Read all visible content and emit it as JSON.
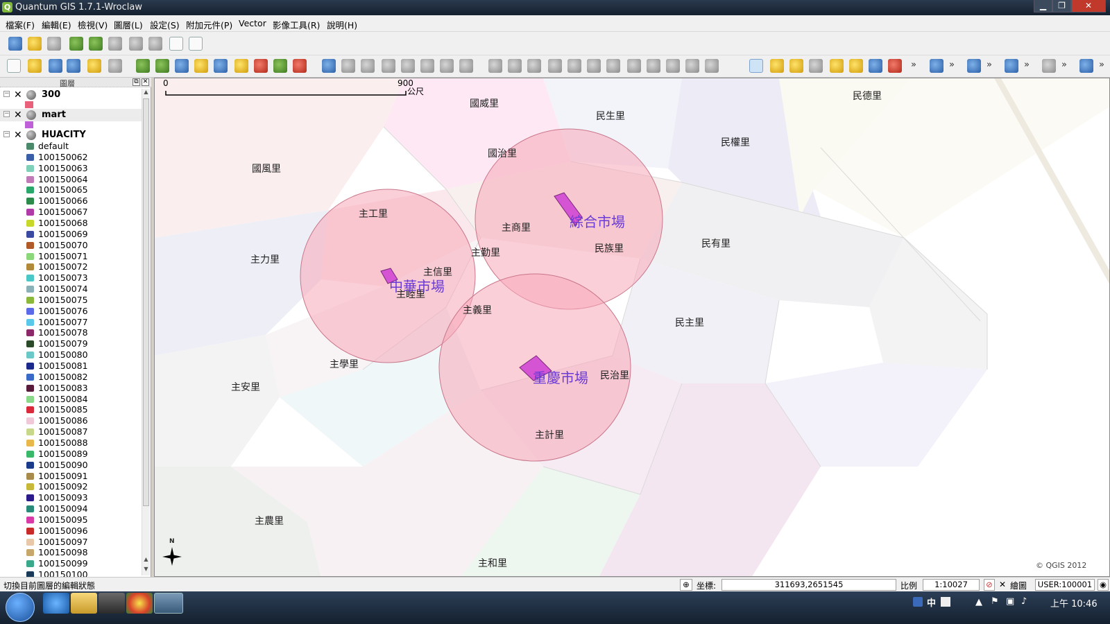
{
  "window": {
    "title": "Quantum GIS 1.7.1-Wroclaw",
    "min": "▁",
    "max": "❐",
    "close": "✕"
  },
  "menu": [
    "檔案(F)",
    "編輯(E)",
    "檢視(V)",
    "圖層(L)",
    "設定(S)",
    "附加元件(P)",
    "Vector",
    "影像工具(R)",
    "說明(H)"
  ],
  "panel": {
    "title": "圖層",
    "layers": [
      {
        "name": "300",
        "checked": "✕",
        "expand": "−"
      },
      {
        "name": "mart",
        "checked": "✕",
        "expand": "−"
      },
      {
        "name": "HUACITY",
        "checked": "✕",
        "expand": "−"
      }
    ],
    "classes": [
      {
        "label": "default",
        "color": "#4a8a6a"
      },
      {
        "label": "100150062",
        "color": "#3a5fa8"
      },
      {
        "label": "100150063",
        "color": "#7fd0b8"
      },
      {
        "label": "100150064",
        "color": "#c07ab8"
      },
      {
        "label": "100150065",
        "color": "#2aa86a"
      },
      {
        "label": "100150066",
        "color": "#2c8a4a"
      },
      {
        "label": "100150067",
        "color": "#b03aa8"
      },
      {
        "label": "100150068",
        "color": "#c8d82a"
      },
      {
        "label": "100150069",
        "color": "#3a4aa0"
      },
      {
        "label": "100150070",
        "color": "#b05a2a"
      },
      {
        "label": "100150071",
        "color": "#8ad87a"
      },
      {
        "label": "100150072",
        "color": "#b08a3a"
      },
      {
        "label": "100150073",
        "color": "#4ac8c8"
      },
      {
        "label": "100150074",
        "color": "#8ab0b8"
      },
      {
        "label": "100150075",
        "color": "#8ab83a"
      },
      {
        "label": "100150076",
        "color": "#5a6ae8"
      },
      {
        "label": "100150077",
        "color": "#5ac8e8"
      },
      {
        "label": "100150078",
        "color": "#8a2a6a"
      },
      {
        "label": "100150079",
        "color": "#2a4a2a"
      },
      {
        "label": "100150080",
        "color": "#6ac8c8"
      },
      {
        "label": "100150081",
        "color": "#1a2a8a"
      },
      {
        "label": "100150082",
        "color": "#3a6ac8"
      },
      {
        "label": "100150083",
        "color": "#5a1a3a"
      },
      {
        "label": "100150084",
        "color": "#8ad88a"
      },
      {
        "label": "100150085",
        "color": "#d82a3a"
      },
      {
        "label": "100150086",
        "color": "#f0c8d8"
      },
      {
        "label": "100150087",
        "color": "#c8d88a"
      },
      {
        "label": "100150088",
        "color": "#e8b84a"
      },
      {
        "label": "100150089",
        "color": "#3ab86a"
      },
      {
        "label": "100150090",
        "color": "#1a3a8a"
      },
      {
        "label": "100150091",
        "color": "#a88a4a"
      },
      {
        "label": "100150092",
        "color": "#c8b83a"
      },
      {
        "label": "100150093",
        "color": "#2a1a8a"
      },
      {
        "label": "100150094",
        "color": "#2a8a7a"
      },
      {
        "label": "100150095",
        "color": "#d83aa8"
      },
      {
        "label": "100150096",
        "color": "#c82a2a"
      },
      {
        "label": "100150097",
        "color": "#e8c8a8"
      },
      {
        "label": "100150098",
        "color": "#c8a86a"
      },
      {
        "label": "100150099",
        "color": "#3aa88a"
      },
      {
        "label": "100150100",
        "color": "#1a3a5a"
      }
    ]
  },
  "map": {
    "scale_start": "0",
    "scale_end": "900",
    "scale_unit": "公尺",
    "north": "N",
    "copyright": "© QGIS 2012",
    "labels": [
      "國威里",
      "民生里",
      "民德里",
      "民權里",
      "國治里",
      "國風里",
      "主工里",
      "主商里",
      "民族里",
      "民有里",
      "主力里",
      "主勤里",
      "主信里",
      "主睦里",
      "主義里",
      "民主里",
      "主學里",
      "民治里",
      "主安里",
      "主計里",
      "主農里",
      "主和里"
    ],
    "markets": [
      "綜合市場",
      "中華市場",
      "重慶市場"
    ]
  },
  "status": {
    "message": "切換目前圖層的編輯狀態",
    "coord_label": "坐標:",
    "coord": "311693,2651545",
    "scale_label": "比例",
    "scale": "1:10027",
    "render_check": "✕",
    "render_label": "繪圖",
    "crs": "USER:100001"
  },
  "taskbar": {
    "ime": "中",
    "time": "上午 10:46"
  }
}
